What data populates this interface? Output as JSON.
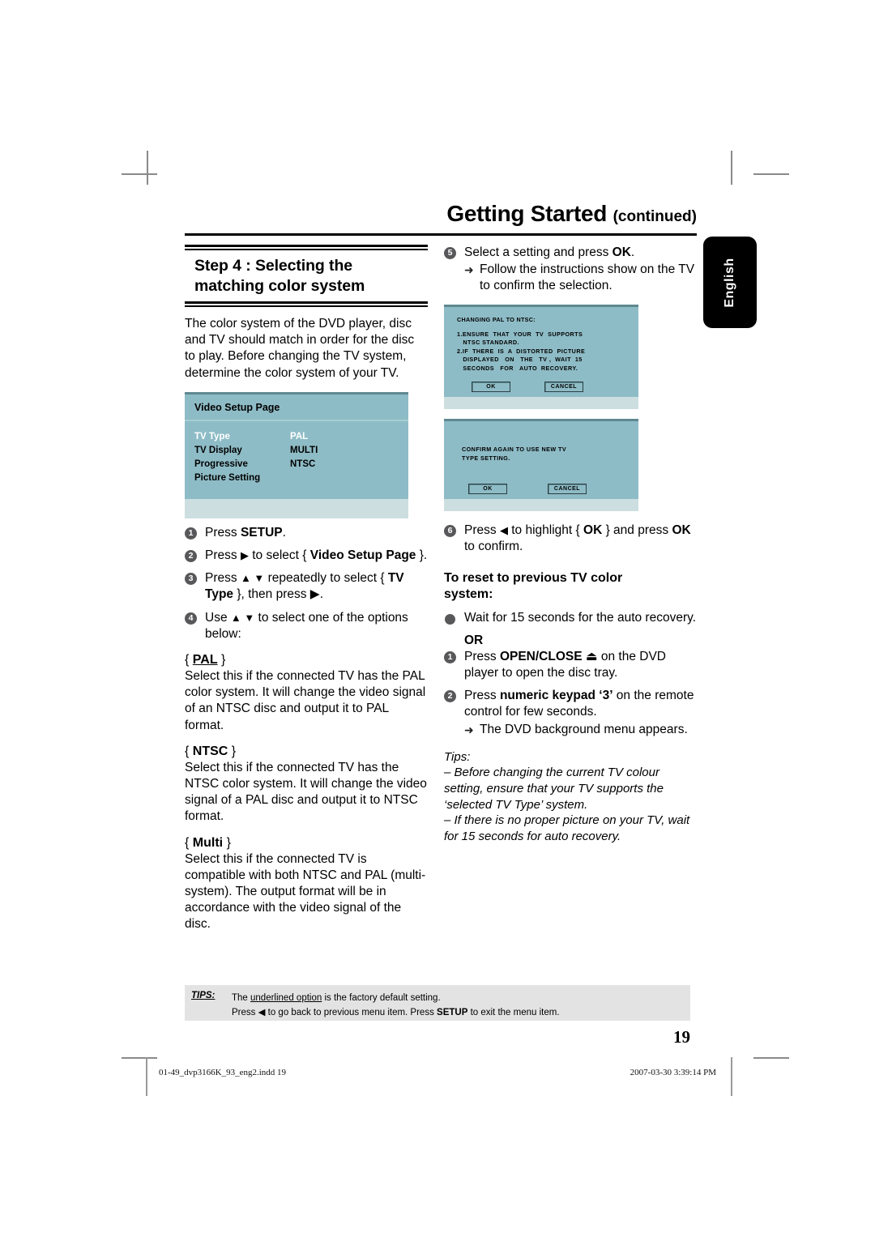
{
  "header": {
    "title": "Getting Started ",
    "continued": "(continued)",
    "language_tab": "English"
  },
  "left_column": {
    "step_heading_line1": "Step 4 : Selecting the",
    "step_heading_line2": "matching color system",
    "intro": "The color system of the DVD player, disc and TV should match in order for the disc to play. Before changing the TV system, determine the color system of your TV.",
    "osd": {
      "title": "Video Setup Page",
      "rows": [
        {
          "label": "TV Type",
          "value": "PAL",
          "highlighted": true
        },
        {
          "label": "TV Display",
          "value": "MULTI",
          "highlighted": false
        },
        {
          "label": "Progressive",
          "value": "NTSC",
          "highlighted": false
        },
        {
          "label": "Picture Setting",
          "value": "",
          "highlighted": false
        }
      ]
    },
    "steps": [
      {
        "num": "1",
        "text_pre": "Press ",
        "bold": "SETUP",
        "text_post": "."
      },
      {
        "num": "2",
        "text_pre": "Press ",
        "arrow": "▶",
        "mid": " to select { ",
        "bold": "Video Setup Page",
        "text_post": " }."
      },
      {
        "num": "3",
        "text_pre": "Press ",
        "arrow": "▲ ▼",
        "mid": " repeatedly to select { ",
        "bold": "TV Type",
        "text_post": " }, then press ▶."
      },
      {
        "num": "4",
        "text_pre": "Use ",
        "arrow": "▲ ▼",
        "mid": " to select one of the options below:",
        "bold": "",
        "text_post": ""
      }
    ],
    "options": [
      {
        "brace_open": "{ ",
        "name": "PAL",
        "brace_close": " }",
        "underlined": true,
        "body": "Select this if the connected TV has the PAL color system. It will change the video signal of an NTSC disc and output it to PAL format."
      },
      {
        "brace_open": "{ ",
        "name": "NTSC",
        "brace_close": " }",
        "underlined": false,
        "body": "Select this if the connected TV has the NTSC color system. It will change the video signal of a PAL disc and output it to NTSC format."
      },
      {
        "brace_open": "{ ",
        "name": "Multi",
        "brace_close": " }",
        "underlined": false,
        "body": "Select this if the connected TV is compatible with both NTSC and PAL (multi-system). The output format will be in accordance with the video signal of the disc."
      }
    ]
  },
  "right_column": {
    "step5": {
      "num": "5",
      "text_pre": "Select a setting and press ",
      "bold": "OK",
      "text_post": ".",
      "sub_arrow": "➜",
      "sub_text": "Follow the instructions show on the TV to confirm the selection."
    },
    "tv_screen_1": {
      "title": "CHANGING PAL TO NTSC:",
      "lines": [
        "1.ENSURE  THAT  YOUR  TV  SUPPORTS",
        "   NTSC STANDARD.",
        "2.IF  THERE  IS  A  DISTORTED  PICTURE",
        "   DISPLAYED   ON   THE   TV ,  WAIT  15",
        "   SECONDS   FOR   AUTO  RECOVERY."
      ],
      "ok_label": "OK",
      "cancel_label": "CANCEL"
    },
    "tv_screen_2": {
      "title": "",
      "lines": [
        "CONFIRM AGAIN TO USE NEW TV",
        "TYPE SETTING."
      ],
      "ok_label": "OK",
      "cancel_label": "CANCEL"
    },
    "step6": {
      "num": "6",
      "text_pre": "Press ",
      "arrow": "◀",
      "mid": " to highlight { ",
      "bold": "OK",
      "text_post": " } and press ",
      "bold2": "OK",
      "tail": " to confirm."
    },
    "reset_heading_line1": "To reset to previous TV color",
    "reset_heading_line2": "system:",
    "reset_bullet": "Wait for 15 seconds for the auto recovery.",
    "or_label": "OR",
    "or_steps": [
      {
        "num": "1",
        "text_pre": "Press ",
        "bold": "OPEN/CLOSE",
        "icon": "⏏",
        "text_post": " on the DVD player to open the disc tray."
      },
      {
        "num": "2",
        "text_pre": "Press ",
        "bold": "numeric keypad ‘3’",
        "icon": "",
        "text_post": " on the remote control for few seconds.",
        "sub_arrow": "➜",
        "sub_text": "The DVD background menu appears."
      }
    ],
    "tips_label": "Tips:",
    "tips": [
      "– Before changing the current TV colour setting, ensure that your TV supports the ‘selected TV Type’ system.",
      "– If there is no proper picture on your TV, wait for 15 seconds for auto recovery."
    ]
  },
  "tips_bar": {
    "label": "TIPS:",
    "line1_pre": "The ",
    "line1_underlined": "underlined option",
    "line1_post": " is the factory default setting.",
    "line2_pre": "Press ",
    "line2_arrow": "◀",
    "line2_mid": " to go back to previous menu item. Press ",
    "line2_bold": "SETUP",
    "line2_post": " to exit the menu item."
  },
  "page_number": "19",
  "imposition": {
    "filename": "01-49_dvp3166K_93_eng2.indd   19",
    "timestamp": "2007-03-30   3:39:14 PM"
  },
  "colors": {
    "osd_teal": "#8ebcc6",
    "osd_foot": "#cddee0",
    "osd_rule": "#5f8891",
    "bullet_gray": "#58585a",
    "tips_bar": "#e3e3e3"
  }
}
